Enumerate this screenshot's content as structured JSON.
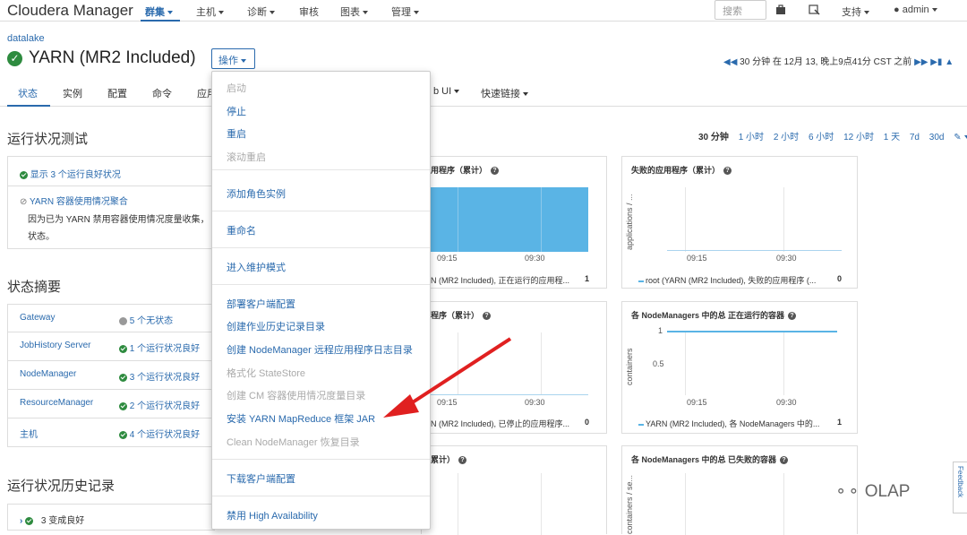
{
  "nav": {
    "brand_light": "Cloudera",
    "brand_bold": "Manager",
    "items": [
      "群集",
      "主机",
      "诊断",
      "审核",
      "图表",
      "管理"
    ],
    "search_placeholder": "搜索",
    "support": "支持",
    "user": "admin"
  },
  "header": {
    "cluster": "datalake",
    "service_title": "YARN (MR2 Included)",
    "actions_label": "操作",
    "time_text": "30 分钟 在 12月 13, 晚上9点41分 CST 之前"
  },
  "tabs": [
    "状态",
    "实例",
    "配置",
    "命令",
    "应用",
    "b UI",
    "快速链接"
  ],
  "health_tests": {
    "title": "运行状况测试",
    "good_link": "显示 3 个运行良好状况",
    "disabled_title": "YARN 容器使用情况聚合",
    "disabled_line1": "因为已为 YARN 禁用容器使用情况度量收集，",
    "disabled_line2": "状态。"
  },
  "status_summary": {
    "title": "状态摘要",
    "rows": [
      {
        "name": "Gateway",
        "state": "5 个无状态",
        "status": "none"
      },
      {
        "name": "JobHistory Server",
        "state": "1 个运行状况良好",
        "status": "good"
      },
      {
        "name": "NodeManager",
        "state": "3 个运行状况良好",
        "status": "good"
      },
      {
        "name": "ResourceManager",
        "state": "2 个运行状况良好",
        "status": "good"
      },
      {
        "name": "主机",
        "state": "4 个运行状况良好",
        "status": "good"
      }
    ]
  },
  "health_history": {
    "title": "运行状况历史记录",
    "row": "3 变成良好"
  },
  "time_range": {
    "current": "30 分钟",
    "options": [
      "1 小时",
      "2 小时",
      "6 小时",
      "12 小时",
      "1 天",
      "7d",
      "30d"
    ]
  },
  "charts": [
    {
      "title": "用程序（累计）",
      "legend": "N (MR2 Included), 正在运行的应用程...",
      "value": "1",
      "ticks": [
        "09:15",
        "09:30"
      ]
    },
    {
      "title": "失败的应用程序（累计）",
      "ylabel": "applications / ...",
      "legend": "root (YARN (MR2 Included), 失败的应用程序 (...",
      "value": "0",
      "ticks": [
        "09:15",
        "09:30"
      ]
    },
    {
      "title": "程序（累计）",
      "legend": "N (MR2 Included), 已停止的应用程序...",
      "value": "0",
      "ticks": [
        "09:15",
        "09:30"
      ]
    },
    {
      "title": "各 NodeManagers 中的总 正在运行的容器",
      "ylabel": "containers",
      "yticks": [
        "1",
        "0.5"
      ],
      "legend": "YARN (MR2 Included), 各 NodeManagers 中的...",
      "value": "1",
      "ticks": [
        "09:15",
        "09:30"
      ]
    },
    {
      "title": "累计）",
      "legend": ""
    },
    {
      "title": "各 NodeManagers 中的总 已失败的容器",
      "ylabel": "containers / se..."
    }
  ],
  "menu": {
    "groups": [
      [
        {
          "label": "启动",
          "enabled": false
        },
        {
          "label": "停止",
          "enabled": true
        },
        {
          "label": "重启",
          "enabled": true
        },
        {
          "label": "滚动重启",
          "enabled": false
        }
      ],
      [
        {
          "label": "添加角色实例",
          "enabled": true
        }
      ],
      [
        {
          "label": "重命名",
          "enabled": true
        }
      ],
      [
        {
          "label": "进入维护模式",
          "enabled": true
        }
      ],
      [
        {
          "label": "部署客户端配置",
          "enabled": true
        },
        {
          "label": "创建作业历史记录目录",
          "enabled": true
        },
        {
          "label": "创建 NodeManager 远程应用程序日志目录",
          "enabled": true
        },
        {
          "label": "格式化 StateStore",
          "enabled": false
        },
        {
          "label": "创建 CM 容器使用情况度量目录",
          "enabled": false
        },
        {
          "label": "安装 YARN MapReduce 框架 JAR",
          "enabled": true
        },
        {
          "label": "Clean NodeManager 恢复目录",
          "enabled": false
        }
      ],
      [
        {
          "label": "下载客户端配置",
          "enabled": true
        }
      ],
      [
        {
          "label": "禁用 High Availability",
          "enabled": true
        }
      ]
    ]
  },
  "feedback": "Feedback",
  "watermark": "OLAP",
  "colors": {
    "accent": "#2a6aad",
    "good": "#2e8b3f",
    "chart_fill": "#5ab4e5",
    "arrow": "#e02020"
  }
}
